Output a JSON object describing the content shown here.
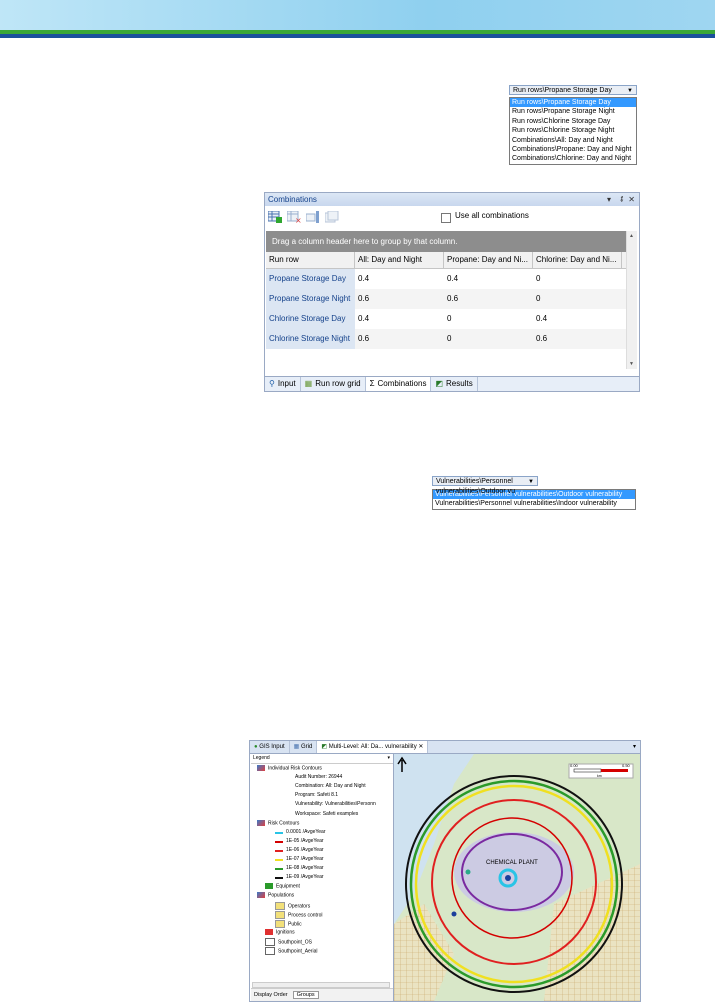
{
  "dropdown_runrows": {
    "selected": "Run rows\\Propane Storage Day",
    "options": [
      "Run rows\\Propane Storage Day",
      "Run rows\\Propane Storage Night",
      "Run rows\\Chlorine Storage Day",
      "Run rows\\Chlorine Storage Night",
      "Combinations\\All: Day and Night",
      "Combinations\\Propane: Day and Night",
      "Combinations\\Chlorine: Day and Night"
    ]
  },
  "combinations_panel": {
    "title": "Combinations",
    "use_all_label": "Use all combinations",
    "group_hint": "Drag a column header here to group by that column.",
    "columns": [
      "Run row",
      "All: Day and Night",
      "Propane: Day and Ni...",
      "Chlorine: Day and Ni..."
    ],
    "rows": [
      {
        "name": "Propane Storage Day",
        "all": "0.4",
        "propane": "0.4",
        "chlorine": "0"
      },
      {
        "name": "Propane Storage Night",
        "all": "0.6",
        "propane": "0.6",
        "chlorine": "0"
      },
      {
        "name": "Chlorine Storage Day",
        "all": "0.4",
        "propane": "0",
        "chlorine": "0.4"
      },
      {
        "name": "Chlorine Storage Night",
        "all": "0.6",
        "propane": "0",
        "chlorine": "0.6"
      }
    ],
    "tabs": [
      "Input",
      "Run row grid",
      "Combinations",
      "Results"
    ],
    "active_tab": "Combinations"
  },
  "dropdown_vuln": {
    "selected": "Vulnerabilities\\Personnel vulnerabilities\\Outdoor vu",
    "options": [
      "Vulnerabilities\\Personnel vulnerabilities\\Outdoor vulnerability",
      "Vulnerabilities\\Personnel vulnerabilities\\Indoor vulnerability"
    ]
  },
  "gis_panel": {
    "tabs": [
      "GIS Input",
      "Grid",
      "Multi-Level: All: Da... vulnerability"
    ],
    "legend_title": "Legend",
    "legend_items": [
      {
        "label": "Individual Risk Contours"
      },
      {
        "label": "Audit Number: 26944"
      },
      {
        "label": "Combination: All: Day and Night"
      },
      {
        "label": "Program: Safeti 8.1"
      },
      {
        "label": "Vulnerability: Vulnerabilities\\Personn"
      },
      {
        "label": "Workspace: Safeti examples"
      },
      {
        "label": "Risk Contours"
      },
      {
        "label": "0.0001 /AvgeYear",
        "color": "#29c4e6"
      },
      {
        "label": "1E-05 /AvgeYear",
        "color": "#d40000"
      },
      {
        "label": "1E-06 /AvgeYear",
        "color": "#e02020"
      },
      {
        "label": "1E-07 /AvgeYear",
        "color": "#f0e020"
      },
      {
        "label": "1E-08 /AvgeYear",
        "color": "#2a9a2a"
      },
      {
        "label": "1E-09 /AvgeYear",
        "color": "#111111"
      },
      {
        "label": "Equipment"
      },
      {
        "label": "Populations"
      },
      {
        "label": "Operators"
      },
      {
        "label": "Process control"
      },
      {
        "label": "Public"
      },
      {
        "label": "Ignitions"
      },
      {
        "label": "Southpoint_OS"
      },
      {
        "label": "Southpoint_Aerial"
      }
    ],
    "footer_left": "Display Order",
    "footer_tab": "Groups",
    "map_label": "CHEMICAL PLANT",
    "scale_min": "0.00",
    "scale_max": "0.50",
    "scale_unit": "km",
    "north": "N"
  }
}
